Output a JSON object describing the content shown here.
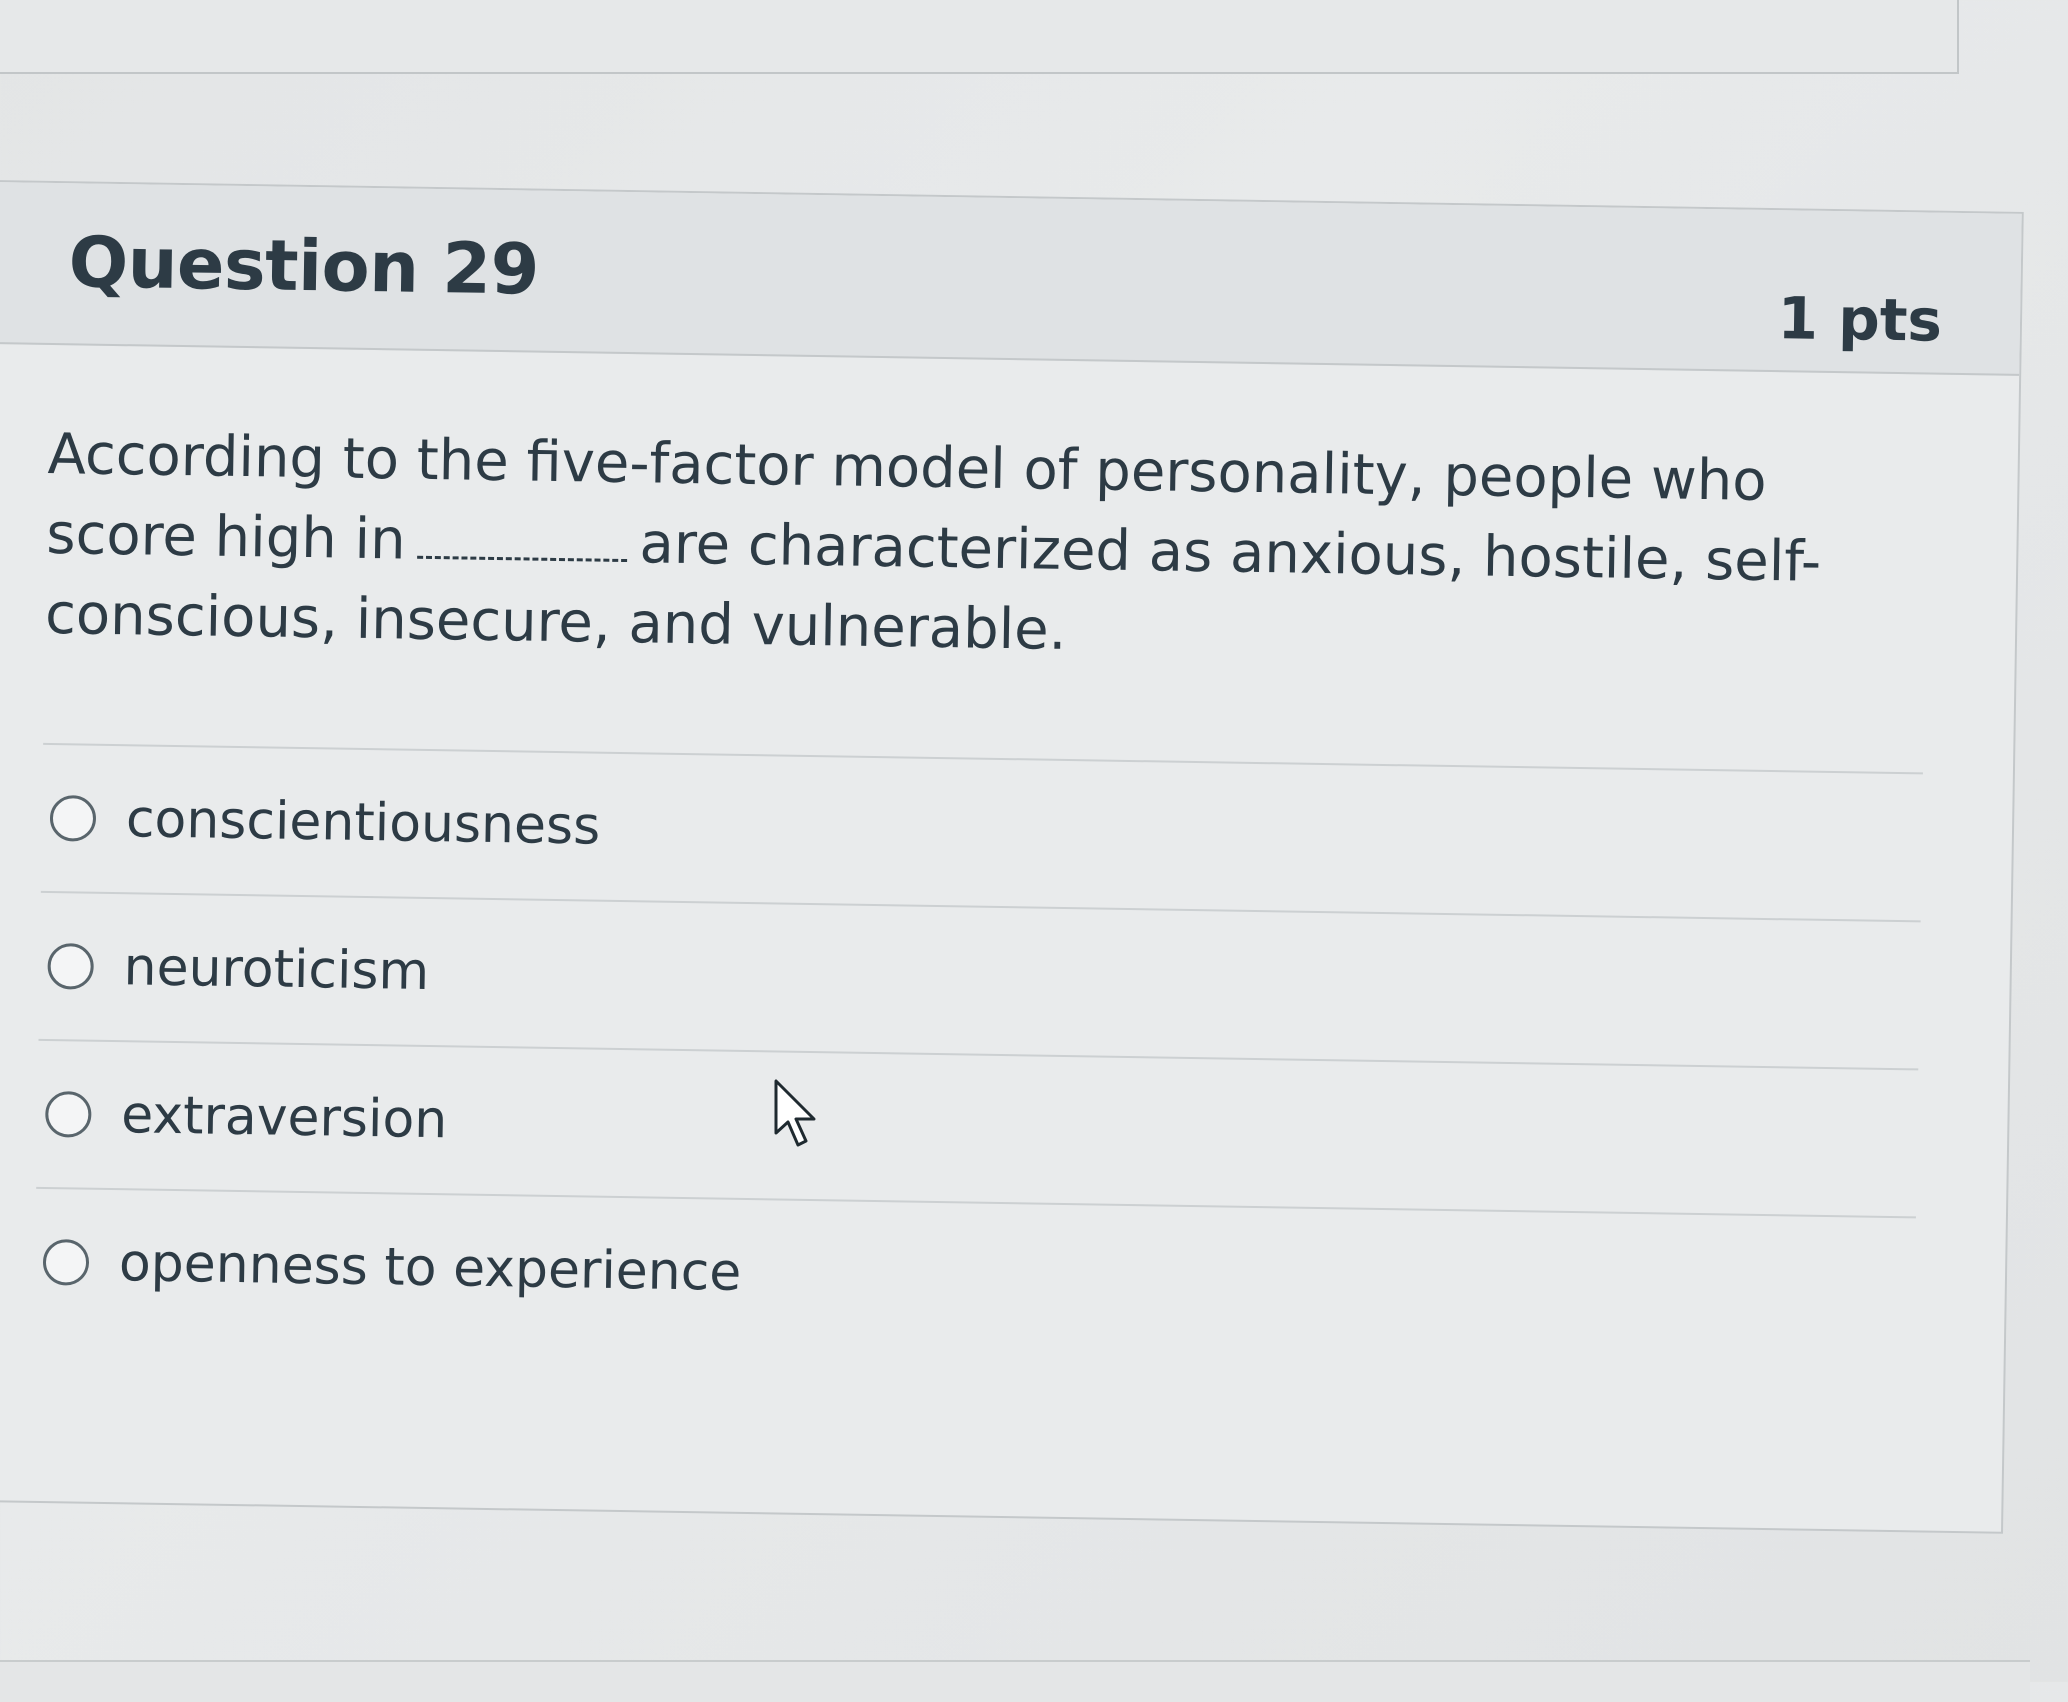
{
  "question": {
    "title": "Question 29",
    "points": "1 pts",
    "text_before_blank": "According to the five-factor model of personality, people who score high in",
    "text_after_blank": "are characterized as anxious, hostile, self-conscious, insecure, and vulnerable."
  },
  "answers": [
    {
      "label": "conscientiousness"
    },
    {
      "label": "neuroticism"
    },
    {
      "label": "extraversion"
    },
    {
      "label": "openness to experience"
    }
  ],
  "cursor": {
    "icon": "arrow-pointer-icon"
  }
}
